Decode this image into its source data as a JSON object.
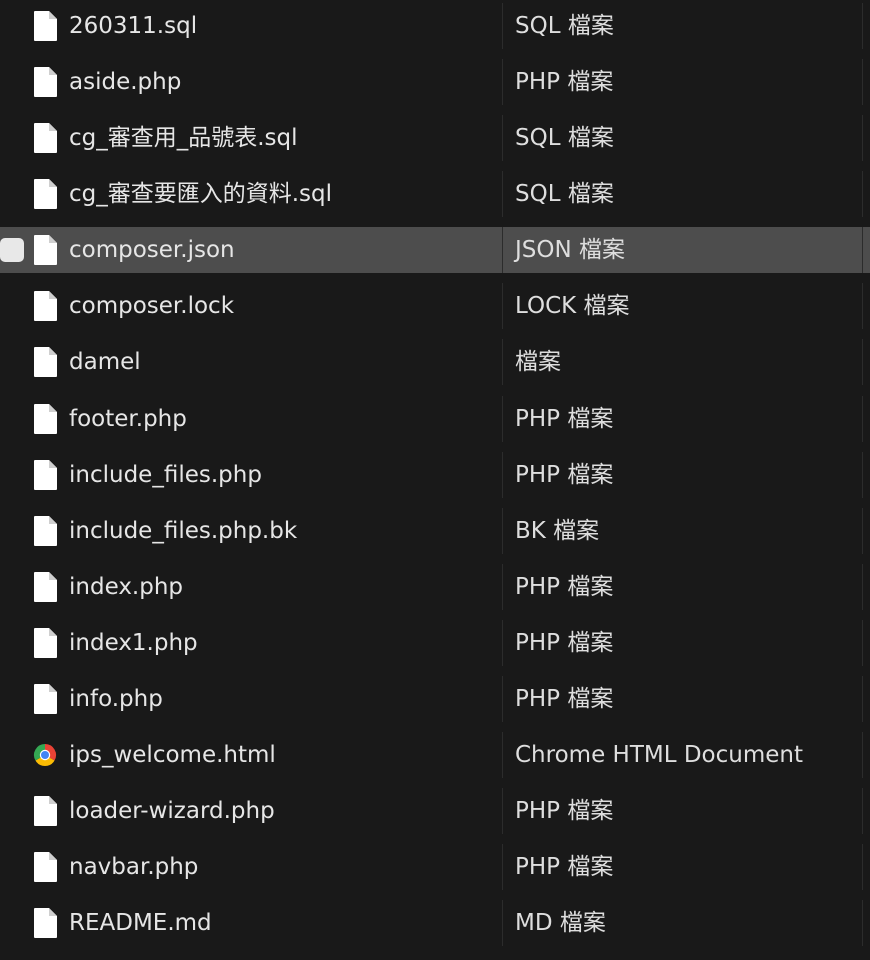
{
  "colors": {
    "background": "#191919",
    "selected_row": "#4d4d4d",
    "text": "#e6e6e6",
    "file_icon": "#ffffff"
  },
  "selected_index": 4,
  "files": [
    {
      "name": "260311.sql",
      "type": "SQL 檔案",
      "icon": "file-icon"
    },
    {
      "name": "aside.php",
      "type": "PHP 檔案",
      "icon": "file-icon"
    },
    {
      "name": "cg_審查用_品號表.sql",
      "type": "SQL 檔案",
      "icon": "file-icon"
    },
    {
      "name": "cg_審查要匯入的資料.sql",
      "type": "SQL 檔案",
      "icon": "file-icon"
    },
    {
      "name": "composer.json",
      "type": "JSON 檔案",
      "icon": "file-icon"
    },
    {
      "name": "composer.lock",
      "type": "LOCK 檔案",
      "icon": "file-icon"
    },
    {
      "name": "damel",
      "type": "檔案",
      "icon": "file-icon"
    },
    {
      "name": "footer.php",
      "type": "PHP 檔案",
      "icon": "file-icon"
    },
    {
      "name": "include_files.php",
      "type": "PHP 檔案",
      "icon": "file-icon"
    },
    {
      "name": "include_files.php.bk",
      "type": "BK 檔案",
      "icon": "file-icon"
    },
    {
      "name": "index.php",
      "type": "PHP 檔案",
      "icon": "file-icon"
    },
    {
      "name": "index1.php",
      "type": "PHP 檔案",
      "icon": "file-icon"
    },
    {
      "name": "info.php",
      "type": "PHP 檔案",
      "icon": "file-icon"
    },
    {
      "name": "ips_welcome.html",
      "type": "Chrome HTML Document",
      "icon": "chrome-icon"
    },
    {
      "name": "loader-wizard.php",
      "type": "PHP 檔案",
      "icon": "file-icon"
    },
    {
      "name": "navbar.php",
      "type": "PHP 檔案",
      "icon": "file-icon"
    },
    {
      "name": "README.md",
      "type": "MD 檔案",
      "icon": "file-icon"
    }
  ]
}
